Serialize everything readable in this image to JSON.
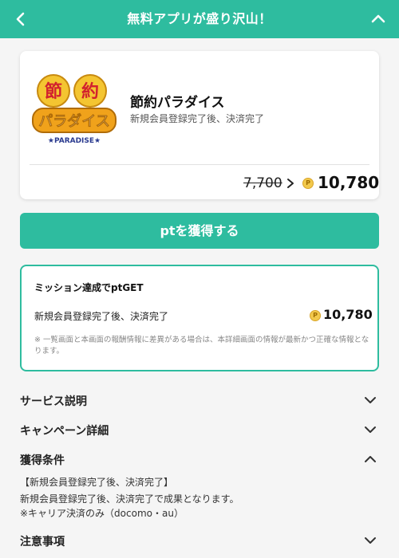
{
  "header": {
    "title": "無料アプリが盛り沢山！"
  },
  "offer": {
    "name": "節約パラダイス",
    "condition": "新規会員登録完了後、決済完了",
    "old_points": "7,700",
    "new_points": "10,780",
    "logo": {
      "line1": "節 約",
      "line2": "パラダイス",
      "line3": "★PARADISE★"
    }
  },
  "cta": {
    "label": "ptを獲得する"
  },
  "mission": {
    "title": "ミッション達成でptGET",
    "condition": "新規会員登録完了後、決済完了",
    "points": "10,780",
    "note": "※ 一覧画面と本画面の報酬情報に差異がある場合は、本詳細画面の情報が最新かつ正確な情報となります。"
  },
  "sections": {
    "service": "サービス説明",
    "campaign": "キャンペーン詳細",
    "conditions": "獲得条件",
    "notes": "注意事項"
  },
  "conditions_detail": {
    "line1": "【新規会員登録完了後、決済完了】",
    "line2": "新規会員登録完了後、決済完了で成果となります。",
    "line3": "※キャリア決済のみ（docomo・au）"
  },
  "colors": {
    "accent": "#2ebc9f",
    "coin": "#f2c94c"
  },
  "icons": {
    "back": "chevron-left-icon",
    "collapse": "chevron-up-icon",
    "point": "point-coin-icon"
  }
}
